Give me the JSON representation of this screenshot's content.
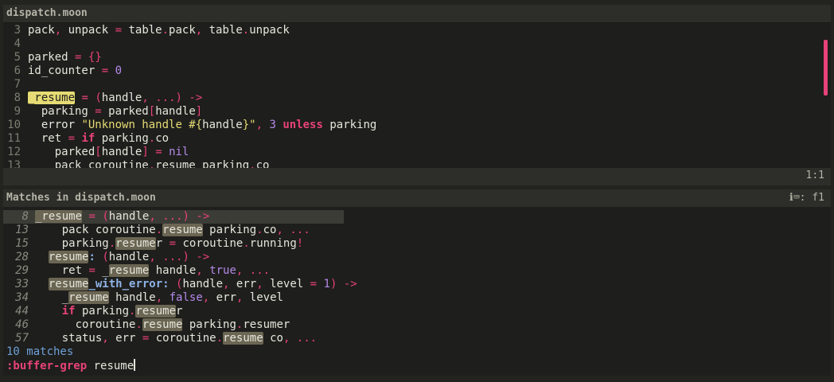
{
  "editor": {
    "title": "dispatch.moon",
    "cursor_position": "1:1",
    "lines": [
      {
        "n": "3",
        "tokens": [
          [
            "pack"
          ],
          [
            ",",
            "p"
          ],
          [
            " unpack "
          ],
          [
            "=",
            "p"
          ],
          [
            " table"
          ],
          [
            ".",
            "p"
          ],
          [
            "pack"
          ],
          [
            ",",
            "p"
          ],
          [
            " table"
          ],
          [
            ".",
            "p"
          ],
          [
            "unpack"
          ]
        ]
      },
      {
        "n": "4",
        "tokens": []
      },
      {
        "n": "5",
        "tokens": [
          [
            "parked "
          ],
          [
            "=",
            "p"
          ],
          [
            " "
          ],
          [
            "{}",
            "p"
          ]
        ]
      },
      {
        "n": "6",
        "tokens": [
          [
            "id_counter "
          ],
          [
            "=",
            "p"
          ],
          [
            " "
          ],
          [
            "0",
            "n"
          ]
        ]
      },
      {
        "n": "7",
        "tokens": []
      },
      {
        "n": "8",
        "tokens": [
          [
            "_resume",
            "hl"
          ],
          [
            " "
          ],
          [
            "=",
            "p"
          ],
          [
            " "
          ],
          [
            "(",
            "p"
          ],
          [
            "handle"
          ],
          [
            ",",
            "p"
          ],
          [
            " "
          ],
          [
            "...",
            "p"
          ],
          [
            ")",
            "p"
          ],
          [
            " "
          ],
          [
            "->",
            "p"
          ]
        ]
      },
      {
        "n": "9",
        "tokens": [
          [
            "  parking "
          ],
          [
            "=",
            "p"
          ],
          [
            " parked"
          ],
          [
            "[",
            "p"
          ],
          [
            "handle"
          ],
          [
            "]",
            "p"
          ]
        ]
      },
      {
        "n": "10",
        "tokens": [
          [
            "  error "
          ],
          [
            "\"Unknown handle #{",
            "s"
          ],
          [
            "handle"
          ],
          [
            "}\"",
            "s"
          ],
          [
            ",",
            "p"
          ],
          [
            " "
          ],
          [
            "3",
            "n"
          ],
          [
            " "
          ],
          [
            "unless",
            "k"
          ],
          [
            " parking"
          ]
        ]
      },
      {
        "n": "11",
        "tokens": [
          [
            "  ret "
          ],
          [
            "=",
            "p"
          ],
          [
            " "
          ],
          [
            "if",
            "k"
          ],
          [
            " parking"
          ],
          [
            ".",
            "p"
          ],
          [
            "co"
          ]
        ]
      },
      {
        "n": "12",
        "tokens": [
          [
            "    parked"
          ],
          [
            "[",
            "p"
          ],
          [
            "handle"
          ],
          [
            "]",
            "p"
          ],
          [
            " "
          ],
          [
            "=",
            "p"
          ],
          [
            " "
          ],
          [
            "nil",
            "n"
          ]
        ]
      },
      {
        "n": "13",
        "tokens": [
          [
            "    pack coroutine"
          ],
          [
            ".",
            "p"
          ],
          [
            "resume parking"
          ],
          [
            ".",
            "p"
          ],
          [
            "co"
          ]
        ]
      }
    ]
  },
  "matches": {
    "title": "Matches in dispatch.moon",
    "header_right": "f1",
    "header_icon": "info-keyboard-icon",
    "summary": "10 matches",
    "command_label": ":buffer-grep",
    "command_value": "resume",
    "items": [
      {
        "n": "8",
        "current": true,
        "tokens": [
          [
            "_resume",
            "mk"
          ],
          [
            " "
          ],
          [
            "=",
            "p"
          ],
          [
            " "
          ],
          [
            "(",
            "p"
          ],
          [
            "handle"
          ],
          [
            ",",
            "p"
          ],
          [
            " "
          ],
          [
            "...",
            "p"
          ],
          [
            ")",
            "p"
          ],
          [
            " "
          ],
          [
            "->",
            "p"
          ]
        ]
      },
      {
        "n": "13",
        "tokens": [
          [
            "    pack coroutine"
          ],
          [
            ".",
            "p"
          ],
          [
            "resume",
            "mk"
          ],
          [
            " parking"
          ],
          [
            ".",
            "p"
          ],
          [
            "co"
          ],
          [
            ",",
            "p"
          ],
          [
            " "
          ],
          [
            "...",
            "p"
          ]
        ]
      },
      {
        "n": "15",
        "tokens": [
          [
            "    parking"
          ],
          [
            ".",
            "p"
          ],
          [
            "resume",
            "mk"
          ],
          [
            "r "
          ],
          [
            "=",
            "p"
          ],
          [
            " coroutine"
          ],
          [
            ".",
            "p"
          ],
          [
            "running"
          ],
          [
            "!",
            "p"
          ]
        ]
      },
      {
        "n": "28",
        "tokens": [
          [
            "  "
          ],
          [
            "resume",
            "mk"
          ],
          [
            ":",
            "f"
          ],
          [
            " "
          ],
          [
            "(",
            "p"
          ],
          [
            "handle"
          ],
          [
            ",",
            "p"
          ],
          [
            " "
          ],
          [
            "...",
            "p"
          ],
          [
            ")",
            "p"
          ],
          [
            " "
          ],
          [
            "->",
            "p"
          ]
        ]
      },
      {
        "n": "29",
        "tokens": [
          [
            "    ret "
          ],
          [
            "=",
            "p"
          ],
          [
            " _"
          ],
          [
            "resume",
            "mk"
          ],
          [
            " handle"
          ],
          [
            ",",
            "p"
          ],
          [
            " "
          ],
          [
            "true",
            "n"
          ],
          [
            ",",
            "p"
          ],
          [
            " "
          ],
          [
            "...",
            "p"
          ]
        ]
      },
      {
        "n": "33",
        "tokens": [
          [
            "  "
          ],
          [
            "resume",
            "mk"
          ],
          [
            "_with_error:",
            "f"
          ],
          [
            " "
          ],
          [
            "(",
            "p"
          ],
          [
            "handle"
          ],
          [
            ",",
            "p"
          ],
          [
            " err"
          ],
          [
            ",",
            "p"
          ],
          [
            " level "
          ],
          [
            "=",
            "p"
          ],
          [
            " "
          ],
          [
            "1",
            "n"
          ],
          [
            ")",
            "p"
          ],
          [
            " "
          ],
          [
            "->",
            "p"
          ]
        ]
      },
      {
        "n": "34",
        "tokens": [
          [
            "    _"
          ],
          [
            "resume",
            "mk"
          ],
          [
            " handle"
          ],
          [
            ",",
            "p"
          ],
          [
            " "
          ],
          [
            "false",
            "n"
          ],
          [
            ",",
            "p"
          ],
          [
            " err"
          ],
          [
            ",",
            "p"
          ],
          [
            " level"
          ]
        ]
      },
      {
        "n": "44",
        "tokens": [
          [
            "    "
          ],
          [
            "if",
            "k"
          ],
          [
            " parking"
          ],
          [
            ".",
            "p"
          ],
          [
            "resume",
            "mk"
          ],
          [
            "r"
          ]
        ]
      },
      {
        "n": "46",
        "tokens": [
          [
            "      coroutine"
          ],
          [
            ".",
            "p"
          ],
          [
            "resume",
            "mk"
          ],
          [
            " parking"
          ],
          [
            ".",
            "p"
          ],
          [
            "resumer"
          ]
        ]
      },
      {
        "n": "57",
        "tokens": [
          [
            "    status"
          ],
          [
            ",",
            "p"
          ],
          [
            " err "
          ],
          [
            "=",
            "p"
          ],
          [
            " coroutine"
          ],
          [
            ".",
            "p"
          ],
          [
            "resume",
            "mk"
          ],
          [
            " co"
          ],
          [
            ",",
            "p"
          ],
          [
            " "
          ],
          [
            "...",
            "p"
          ]
        ]
      }
    ]
  }
}
